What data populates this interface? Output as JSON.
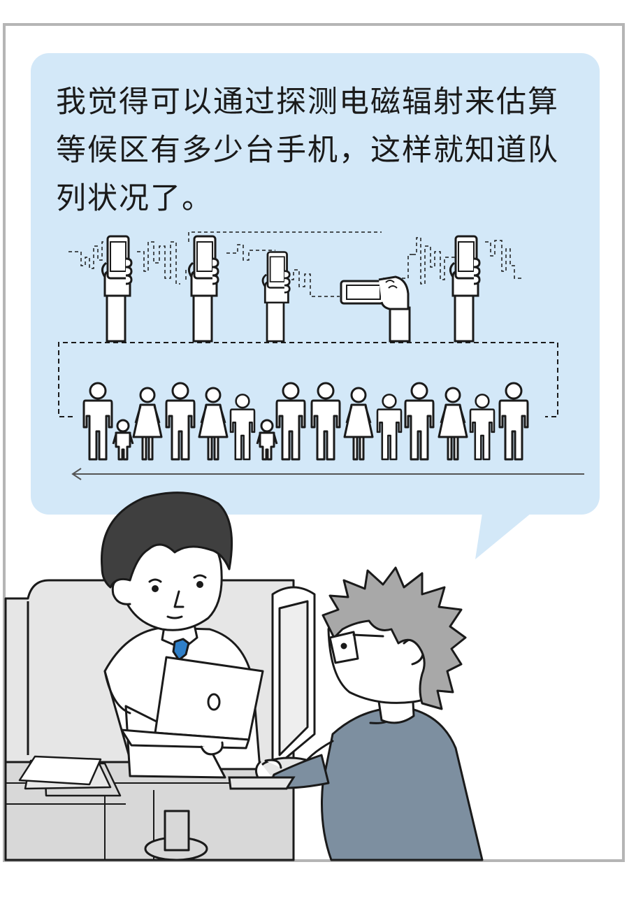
{
  "speech_bubble": {
    "text": "我觉得可以通过探测电磁辐射来估算等候区有多少台手机，这样就知道队列状况了。"
  },
  "colors": {
    "bubble_fill": "#d3e8f8",
    "frame_border": "#b5b5b5",
    "ink": "#1a1a1a",
    "tie": "#2f7fc8",
    "shirt": "#7d8fa0",
    "hair_gray": "#a8a8a8",
    "furniture": "#e6e6e6"
  },
  "illustration": {
    "phones_held_up": 5,
    "people_in_queue": 16,
    "queue_direction": "left",
    "icons": [
      "hand-holding-phone-icon",
      "signal-wave-icon",
      "person-icon",
      "child-icon",
      "arrow-left-icon",
      "laptop-icon"
    ]
  }
}
